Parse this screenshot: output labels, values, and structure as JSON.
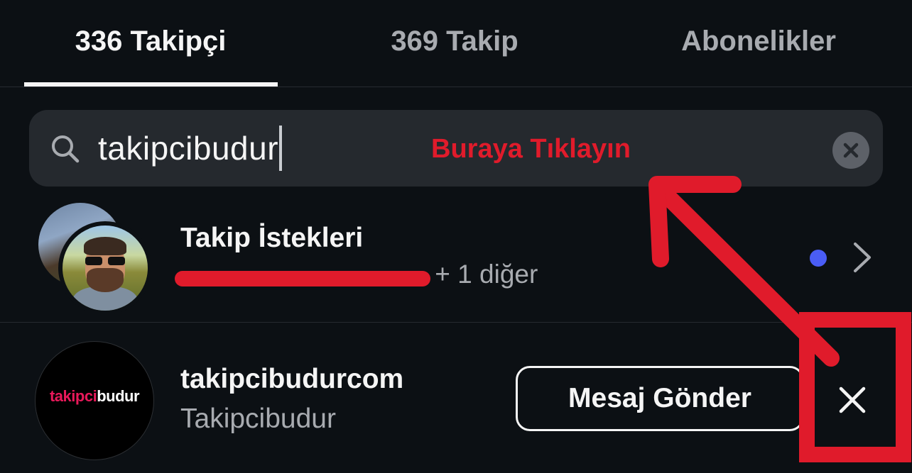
{
  "tabs": [
    {
      "label": "336 Takipçi",
      "active": true
    },
    {
      "label": "369 Takip",
      "active": false
    },
    {
      "label": "Abonelikler",
      "active": false
    }
  ],
  "search": {
    "value": "takipcibudur",
    "icon": "search-icon",
    "clear_icon": "clear-icon"
  },
  "annotation": {
    "hint": "Buraya Tıklayın",
    "color": "#e01b2b"
  },
  "follow_requests": {
    "title": "Takip İstekleri",
    "suffix": "+ 1 diğer",
    "badge_color": "#4a5df5"
  },
  "follower": {
    "username": "takipcibudurcom",
    "display_name": "Takipcibudur",
    "logo_part1": "takipci",
    "logo_part2": "budur",
    "message_button": "Mesaj Gönder"
  },
  "colors": {
    "background": "#0c1014",
    "search_bg": "#25292e",
    "muted_text": "#a8abb0",
    "accent_red": "#e01b2b"
  }
}
